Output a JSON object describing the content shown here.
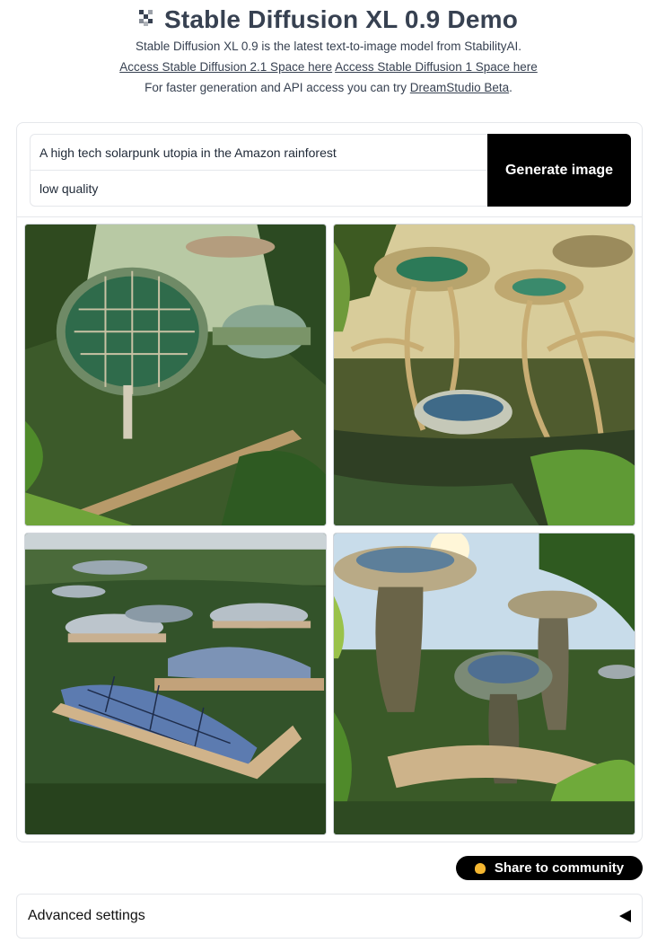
{
  "header": {
    "title": "Stable Diffusion XL 0.9 Demo",
    "logo_icon": "pixel-logo-icon",
    "description": "Stable Diffusion XL 0.9 is the latest text-to-image model from StabilityAI.",
    "link_sd21": "Access Stable Diffusion 2.1 Space here",
    "link_sd1": "Access Stable Diffusion 1 Space here",
    "api_text": "For faster generation and API access you can try",
    "api_link": "DreamStudio Beta",
    "api_suffix": "."
  },
  "form": {
    "prompt_value": "A high tech solarpunk utopia in the Amazon rainforest",
    "negative_value": "low quality",
    "generate_label": "Generate image"
  },
  "gallery": {
    "count": 4
  },
  "share": {
    "label": "Share to community",
    "icon": "hand-icon"
  },
  "advanced": {
    "label": "Advanced settings",
    "icon": "triangle-left-icon"
  }
}
